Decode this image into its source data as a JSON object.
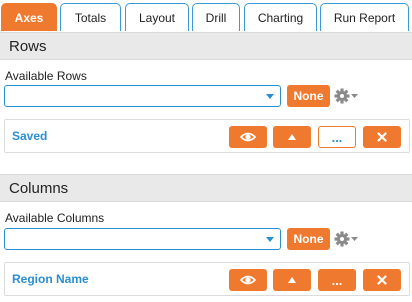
{
  "tabs": [
    {
      "label": "Axes",
      "active": true
    },
    {
      "label": "Totals",
      "active": false
    },
    {
      "label": "Layout",
      "active": false
    },
    {
      "label": "Drill",
      "active": false
    },
    {
      "label": "Charting",
      "active": false
    },
    {
      "label": "Run Report",
      "active": false
    }
  ],
  "rows": {
    "header": "Rows",
    "available_label": "Available Rows",
    "select_value": "",
    "none_label": "None",
    "axis_item": "Saved",
    "dots_label": "..."
  },
  "columns": {
    "header": "Columns",
    "available_label": "Available Columns",
    "select_value": "",
    "none_label": "None",
    "axis_item": "Region Name",
    "dots_label": "..."
  },
  "icons": {
    "settings": "gear-icon",
    "view": "eye-icon",
    "move_up": "chevron-up-icon",
    "remove": "close-icon"
  },
  "colors": {
    "accent": "#ef7a2f",
    "link": "#2a8fd0",
    "header_bg": "#e9e9e9"
  }
}
